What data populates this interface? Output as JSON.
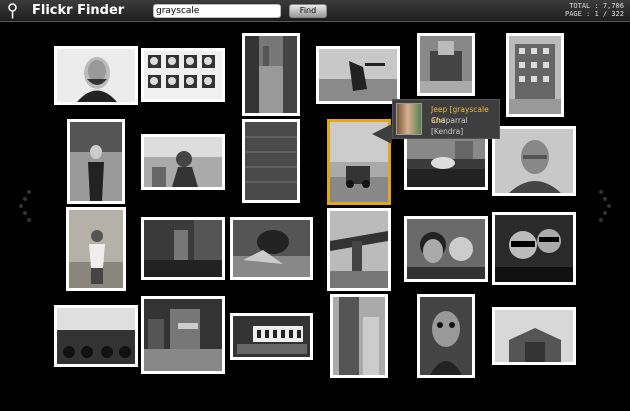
{
  "header": {
    "title": "Flickr Finder",
    "search_value": "grayscale",
    "find_label": "Find",
    "total_text": "TOTAL : 7,706",
    "page_text": "PAGE : 1 / 322"
  },
  "tooltip": {
    "title": "Jeep [grayscale and",
    "title_rest": "Chaparral",
    "owner": "[Kendra]"
  },
  "icons": [
    "keyhole-icon",
    "nav-left-icon",
    "nav-right-icon"
  ],
  "colors": {
    "background": "#000000",
    "selected_border": "#e0a818",
    "tooltip_title": "#f2b838"
  }
}
